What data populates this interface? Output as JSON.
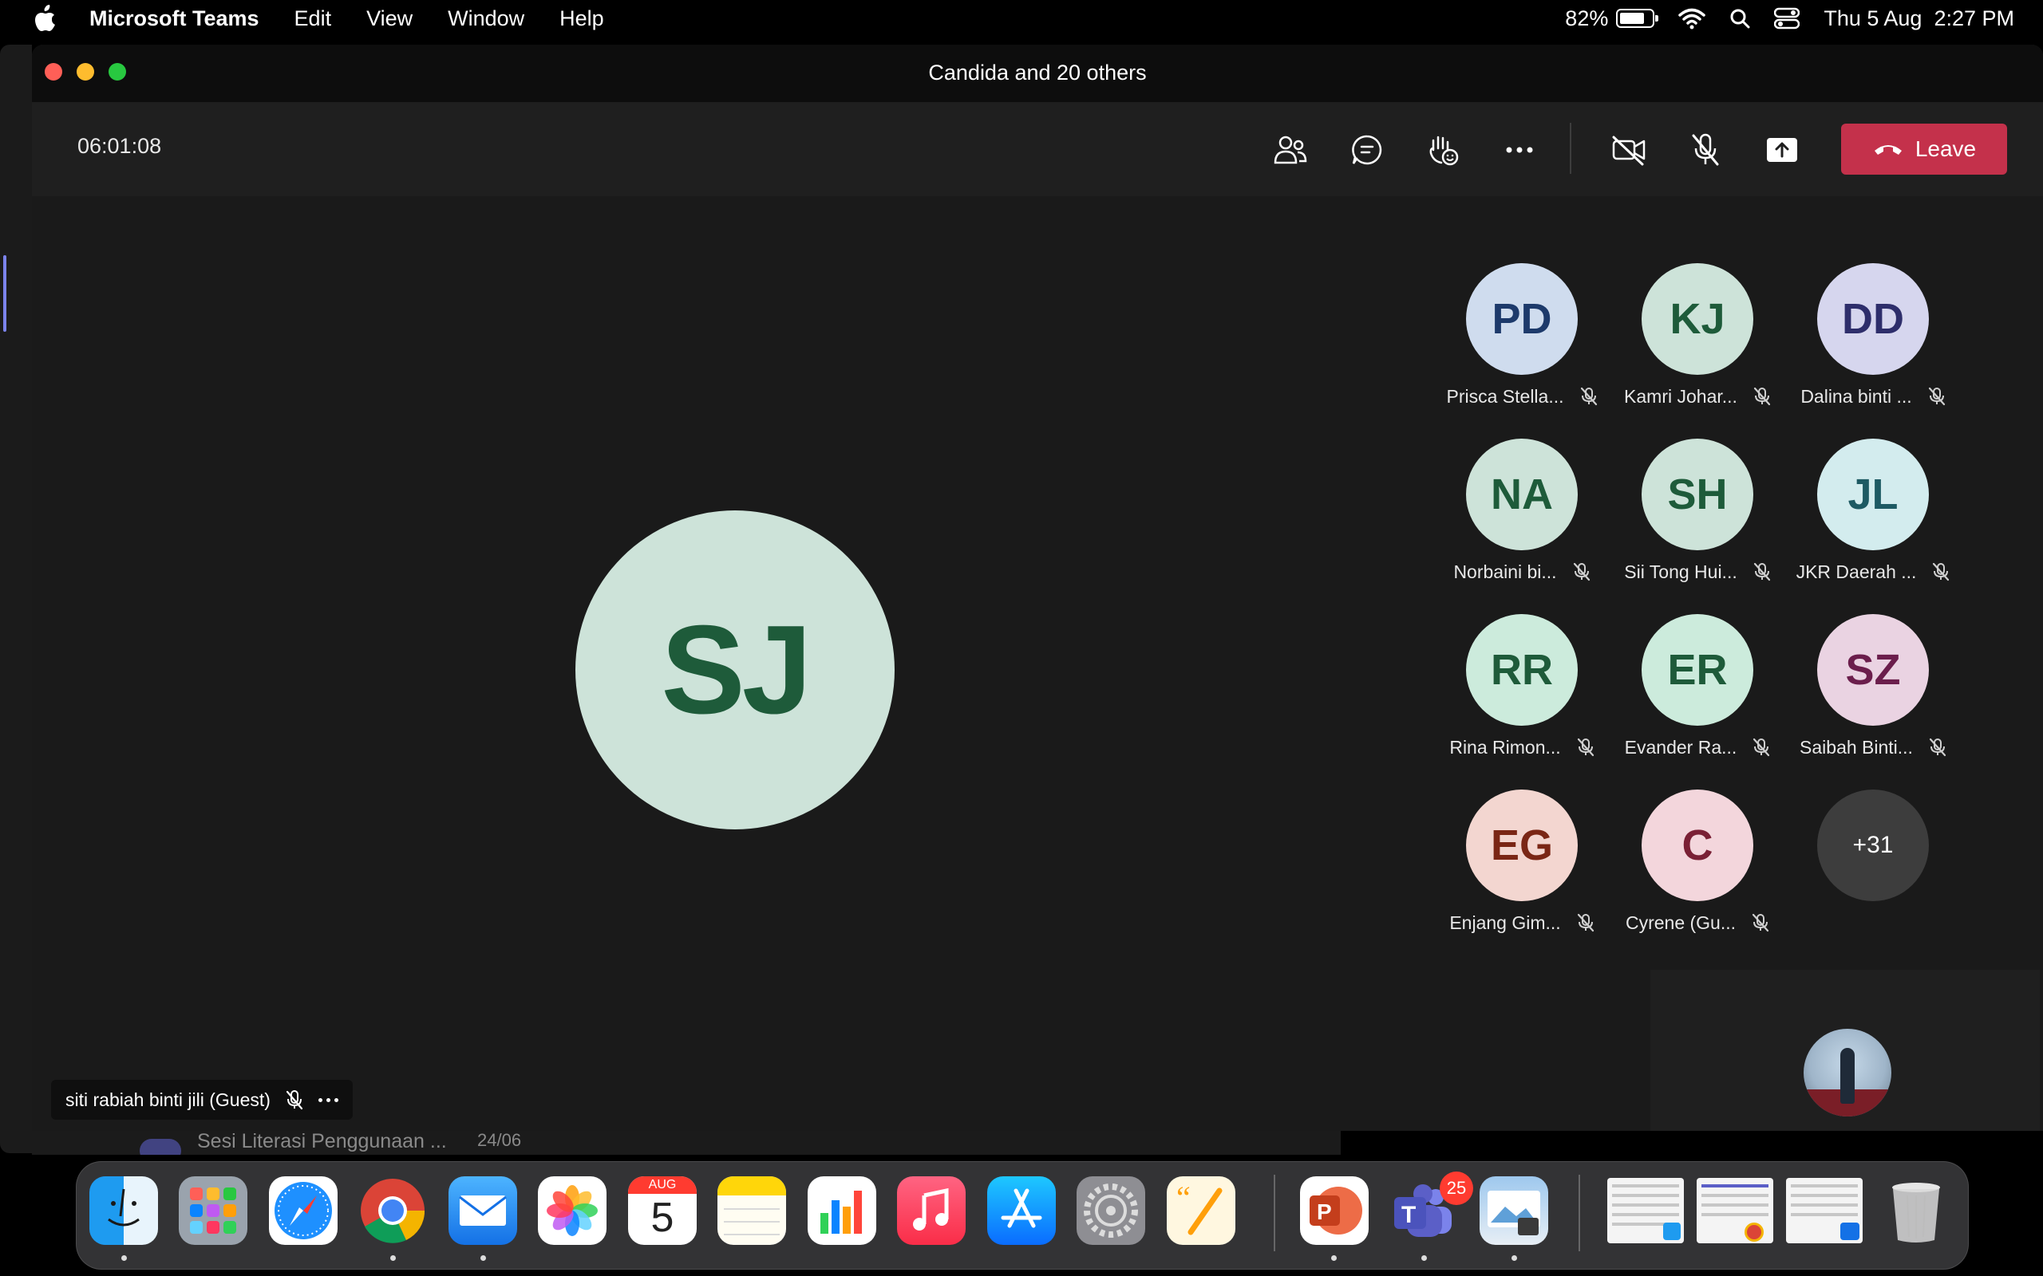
{
  "menubar": {
    "app_name": "Microsoft Teams",
    "menus": [
      "Edit",
      "View",
      "Window",
      "Help"
    ],
    "battery": "82%",
    "battery_level": 0.82,
    "datetime": "Thu 5 Aug  2:27 PM"
  },
  "window": {
    "title": "Candida and 20 others"
  },
  "toolbar": {
    "timer": "06:01:08",
    "leave_label": "Leave",
    "leave_color": "#c4314b"
  },
  "stage": {
    "main_initials": "SJ",
    "speaker_label": "siti rabiah binti jili (Guest)"
  },
  "participants": [
    {
      "initials": "PD",
      "name": "Prisca Stella...",
      "bg": "#cfdcee",
      "fg": "#1d3a6b"
    },
    {
      "initials": "KJ",
      "name": "Kamri Johar...",
      "bg": "#cde3d9",
      "fg": "#1e5b3a"
    },
    {
      "initials": "DD",
      "name": "Dalina binti ...",
      "bg": "#d6d6ee",
      "fg": "#2e2e6b"
    },
    {
      "initials": "NA",
      "name": "Norbaini bi...",
      "bg": "#cde3d9",
      "fg": "#1e5b3a"
    },
    {
      "initials": "SH",
      "name": "Sii Tong Hui...",
      "bg": "#cde3d9",
      "fg": "#1e5b3a"
    },
    {
      "initials": "JL",
      "name": "JKR Daerah ...",
      "bg": "#d3ecee",
      "fg": "#1d5a63"
    },
    {
      "initials": "RR",
      "name": "Rina Rimon...",
      "bg": "#ccebdc",
      "fg": "#1e5b3a"
    },
    {
      "initials": "ER",
      "name": "Evander Ra...",
      "bg": "#ccebdc",
      "fg": "#1e5b3a"
    },
    {
      "initials": "SZ",
      "name": "Saibah Binti...",
      "bg": "#ead3e2",
      "fg": "#6b1e4c"
    },
    {
      "initials": "EG",
      "name": "Enjang Gim...",
      "bg": "#f3d6d0",
      "fg": "#7a2615"
    },
    {
      "initials": "C",
      "name": "Cyrene (Gu...",
      "bg": "#f3d6dc",
      "fg": "#7a2035"
    }
  ],
  "more_participants": "+31",
  "background_window": {
    "item_title": "Sesi Literasi Penggunaan ...",
    "item_date": "24/06"
  },
  "dock": {
    "calendar_month": "AUG",
    "calendar_day": "5",
    "teams_badge": "25"
  }
}
